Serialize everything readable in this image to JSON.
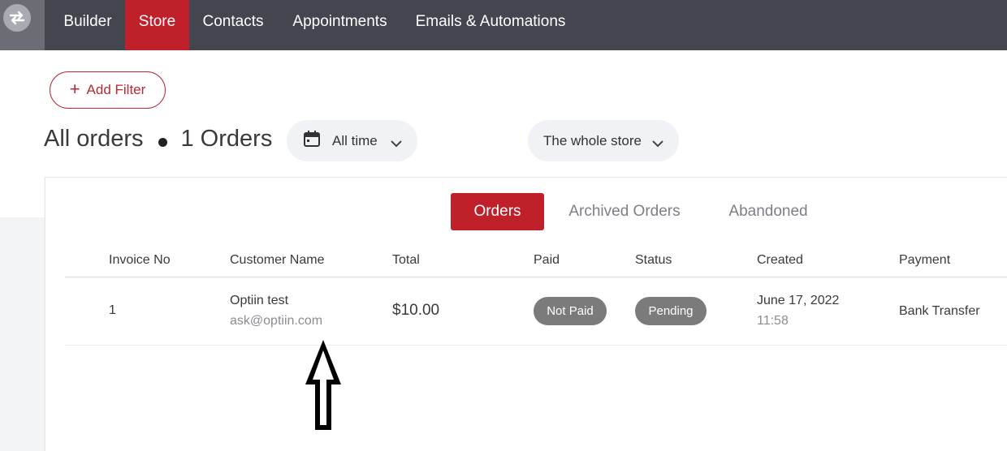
{
  "nav": {
    "items": [
      "Builder",
      "Store",
      "Contacts",
      "Appointments",
      "Emails & Automations"
    ],
    "active_color": "#c0202a",
    "bar_color": "#43454f"
  },
  "toolbar": {
    "add_filter_label": "Add Filter"
  },
  "heading": {
    "title": "All orders",
    "count": "1 Orders"
  },
  "filters": {
    "time": "All time",
    "scope": "The whole store"
  },
  "tabs": [
    "Orders",
    "Archived Orders",
    "Abandoned"
  ],
  "table": {
    "columns": [
      "Invoice No",
      "Customer Name",
      "Total",
      "Paid",
      "Status",
      "Created",
      "Payment"
    ],
    "rows": [
      {
        "invoice": "1",
        "customer_name": "Optiin test",
        "customer_email": "ask@optiin.com",
        "total": "$10.00",
        "paid": "Not Paid",
        "status": "Pending",
        "created_date": "June 17, 2022",
        "created_time": "11:58",
        "payment": "Bank Transfer"
      }
    ]
  },
  "icons": {
    "switcher": "swap-arrows-icon",
    "add": "plus-icon",
    "calendar": "calendar-icon",
    "dropdown": "chevron-down-icon",
    "annotation": "up-arrow-annotation"
  }
}
